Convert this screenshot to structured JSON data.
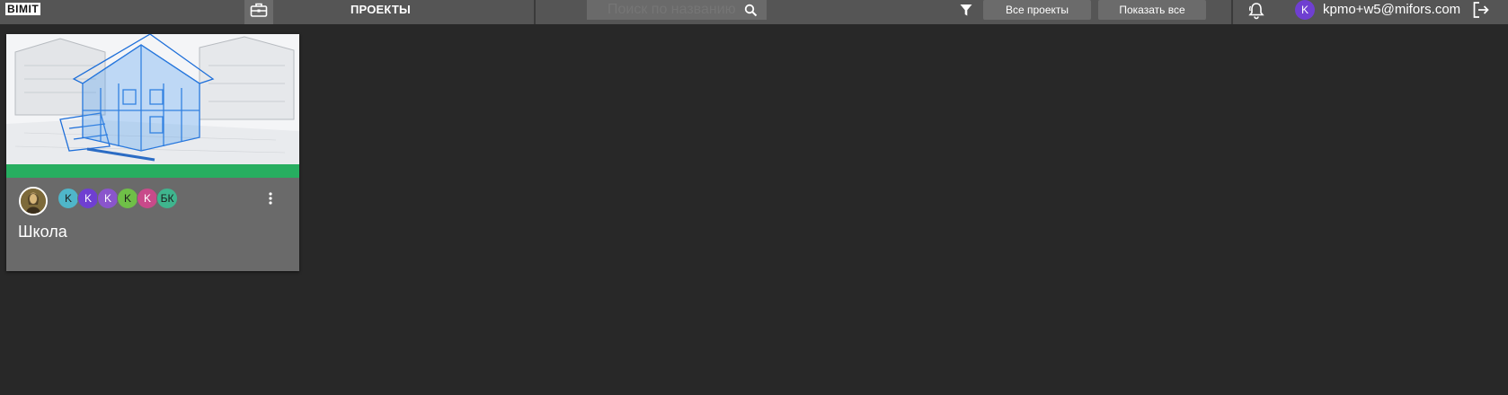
{
  "header": {
    "logo": "BIMIT",
    "section_title": "ПРОЕКТЫ",
    "search": {
      "placeholder": "Поиск по названию"
    },
    "buttons": {
      "all_projects": "Все проекты",
      "show_all": "Показать все"
    },
    "user": {
      "avatar_letter": "K",
      "email": "kpmo+w5@mifors.com"
    },
    "icons": [
      "briefcase-icon",
      "search-icon",
      "filter-icon",
      "bell-icon",
      "logout-icon"
    ]
  },
  "projects": [
    {
      "name": "Школа",
      "status_color": "#27ae60",
      "members": [
        {
          "initials": "K",
          "color": "#4fb6c9"
        },
        {
          "initials": "K",
          "color": "#6f3fd1"
        },
        {
          "initials": "K",
          "color": "#8a55cc"
        },
        {
          "initials": "K",
          "color": "#6fbf47"
        },
        {
          "initials": "K",
          "color": "#c84a8a"
        },
        {
          "initials": "БК",
          "color": "#3fb58e"
        }
      ]
    }
  ],
  "colors": {
    "background": "#282828",
    "header": "#555555",
    "accent": "#6f3fd1"
  }
}
